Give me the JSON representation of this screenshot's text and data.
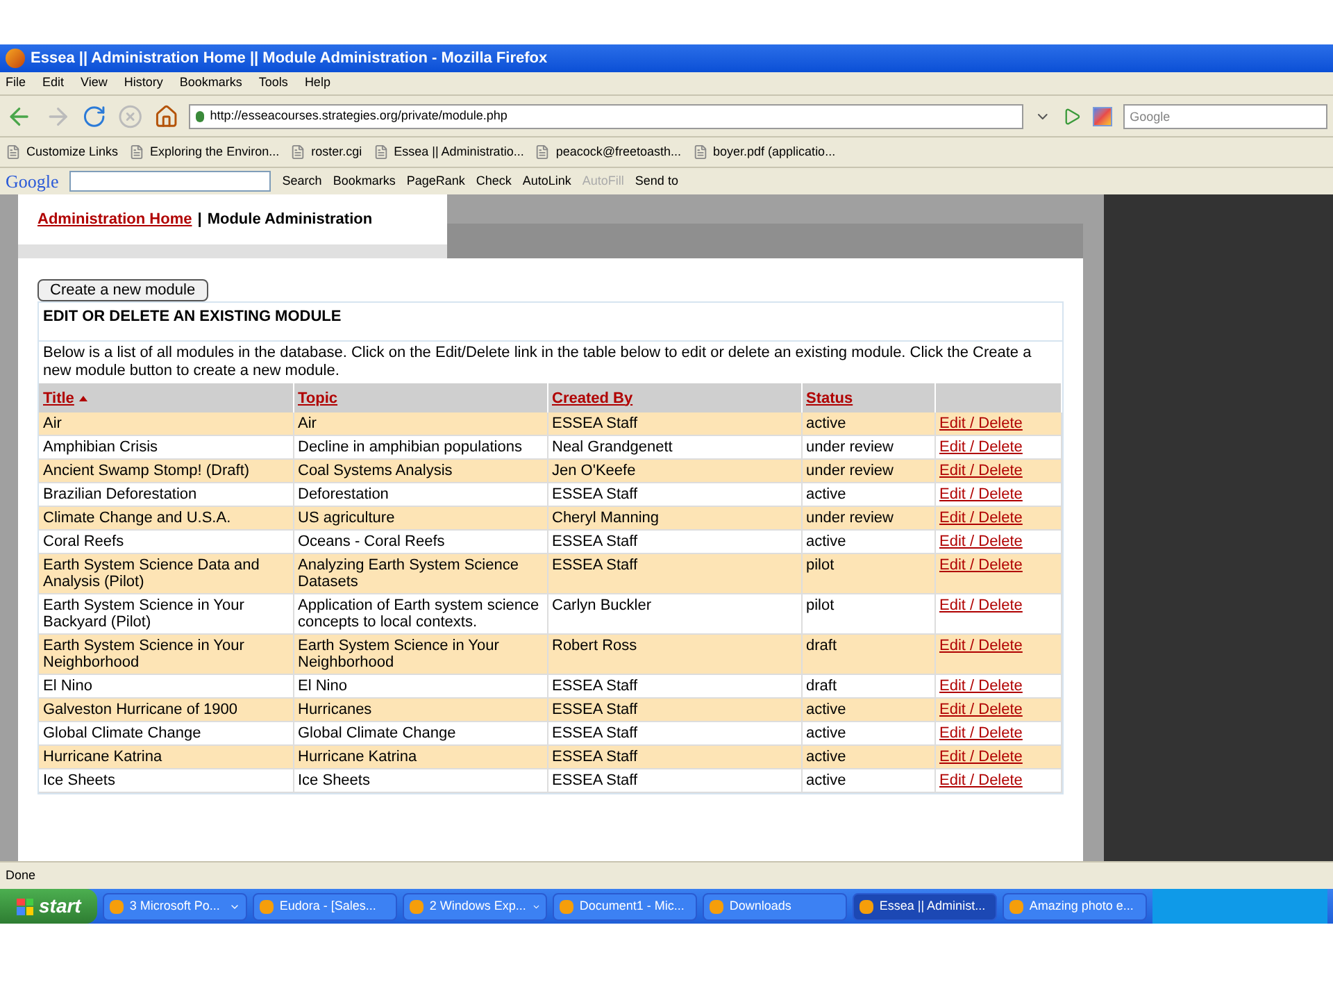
{
  "window": {
    "title": "Essea || Administration Home || Module Administration - Mozilla Firefox"
  },
  "menu": [
    "File",
    "Edit",
    "View",
    "History",
    "Bookmarks",
    "Tools",
    "Help"
  ],
  "address": {
    "value": "http://esseacourses.strategies.org/private/module.php"
  },
  "search_box": {
    "placeholder": "Google"
  },
  "bookmarks": [
    {
      "label": "Customize Links"
    },
    {
      "label": "Exploring the Environ..."
    },
    {
      "label": "roster.cgi"
    },
    {
      "label": "Essea || Administratio..."
    },
    {
      "label": "peacock@freetoasth..."
    },
    {
      "label": "boyer.pdf (applicatio..."
    }
  ],
  "google_toolbar": {
    "logo": "Google",
    "items": [
      "Search",
      "Bookmarks",
      "PageRank",
      "Check",
      "AutoLink",
      "AutoFill",
      "Send to"
    ]
  },
  "breadcrumb": {
    "link": "Administration Home",
    "separator": "|",
    "current": "Module Administration"
  },
  "create_button": "Create a new module",
  "section_title": "EDIT OR DELETE AN EXISTING MODULE",
  "description": "Below is a list of all modules in the database. Click on the Edit/Delete link in the table below to edit or delete an existing module. Click the Create a new module button to create a new module.",
  "table": {
    "columns": [
      {
        "label": "Title",
        "sorted": true
      },
      {
        "label": "Topic",
        "sorted": false
      },
      {
        "label": "Created By",
        "sorted": false
      },
      {
        "label": "Status",
        "sorted": false
      }
    ],
    "rows": [
      {
        "title": "Air",
        "topic": "Air",
        "created_by": "ESSEA Staff",
        "status": "active",
        "action": "Edit / Delete"
      },
      {
        "title": "Amphibian Crisis",
        "topic": "Decline in amphibian populations",
        "created_by": "Neal Grandgenett",
        "status": "under review",
        "action": "Edit / Delete"
      },
      {
        "title": "Ancient Swamp Stomp! (Draft)",
        "topic": "Coal Systems Analysis",
        "created_by": "Jen O'Keefe",
        "status": "under review",
        "action": "Edit / Delete"
      },
      {
        "title": "Brazilian Deforestation",
        "topic": "Deforestation",
        "created_by": "ESSEA Staff",
        "status": "active",
        "action": "Edit / Delete"
      },
      {
        "title": "Climate Change and U.S.A.",
        "topic": "US agriculture",
        "created_by": "Cheryl Manning",
        "status": "under review",
        "action": "Edit / Delete"
      },
      {
        "title": "Coral Reefs",
        "topic": "Oceans - Coral Reefs",
        "created_by": "ESSEA Staff",
        "status": "active",
        "action": "Edit / Delete"
      },
      {
        "title": "Earth System Science Data and Analysis (Pilot)",
        "topic": "Analyzing Earth System Science Datasets",
        "created_by": "ESSEA Staff",
        "status": "pilot",
        "action": "Edit / Delete"
      },
      {
        "title": "Earth System Science in Your Backyard (Pilot)",
        "topic": "Application of Earth system science concepts to local contexts.",
        "created_by": "Carlyn Buckler",
        "status": "pilot",
        "action": "Edit / Delete"
      },
      {
        "title": "Earth System Science in Your Neighborhood",
        "topic": "Earth System Science in Your Neighborhood",
        "created_by": "Robert Ross",
        "status": "draft",
        "action": "Edit / Delete"
      },
      {
        "title": "El Nino",
        "topic": "El Nino",
        "created_by": "ESSEA Staff",
        "status": "draft",
        "action": "Edit / Delete"
      },
      {
        "title": "Galveston Hurricane of 1900",
        "topic": "Hurricanes",
        "created_by": "ESSEA Staff",
        "status": "active",
        "action": "Edit / Delete"
      },
      {
        "title": "Global Climate Change",
        "topic": "Global Climate Change",
        "created_by": "ESSEA Staff",
        "status": "active",
        "action": "Edit / Delete"
      },
      {
        "title": "Hurricane Katrina",
        "topic": "Hurricane Katrina",
        "created_by": "ESSEA Staff",
        "status": "active",
        "action": "Edit / Delete"
      },
      {
        "title": "Ice Sheets",
        "topic": "Ice Sheets",
        "created_by": "ESSEA Staff",
        "status": "active",
        "action": "Edit / Delete"
      }
    ]
  },
  "status_bar": "Done",
  "taskbar": {
    "start": "start",
    "tasks": [
      {
        "label": "3 Microsoft Po...",
        "kind": "group",
        "selected": false
      },
      {
        "label": "Eudora - [Sales...",
        "kind": "single",
        "selected": false
      },
      {
        "label": "2 Windows Exp...",
        "kind": "group",
        "selected": false
      },
      {
        "label": "Document1 - Mic...",
        "kind": "single",
        "selected": false
      },
      {
        "label": "Downloads",
        "kind": "single",
        "selected": false
      },
      {
        "label": "Essea || Administ...",
        "kind": "single",
        "selected": true
      },
      {
        "label": "Amazing photo e...",
        "kind": "single",
        "selected": false
      }
    ]
  }
}
